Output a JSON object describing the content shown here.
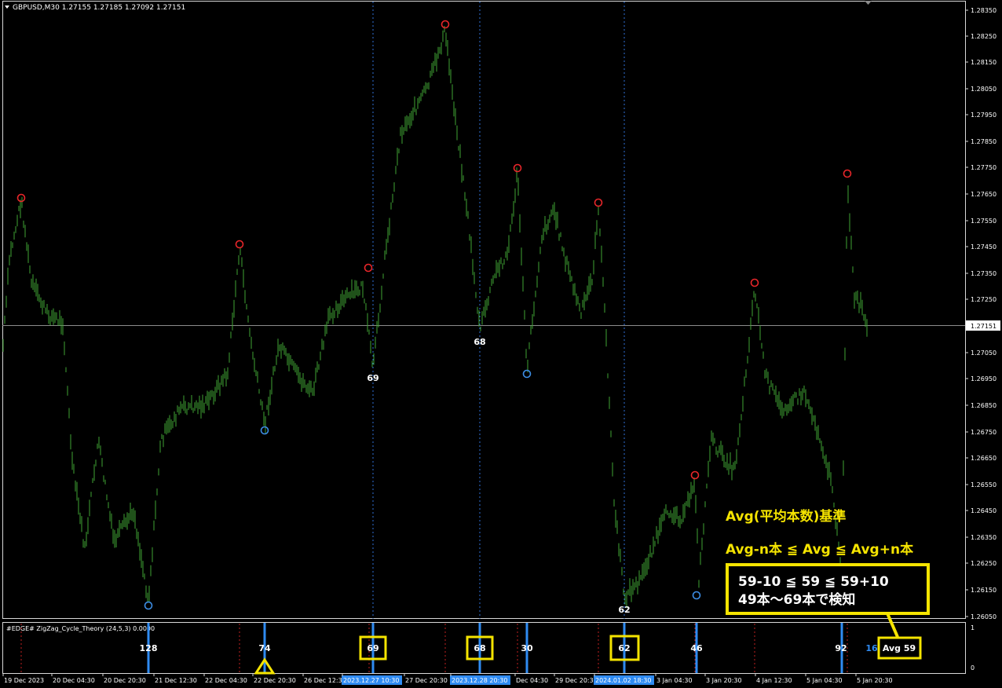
{
  "header": {
    "menu_icon": "triangle-down-icon",
    "title": "GBPUSD,M30  1.27155 1.27185 1.27092 1.27151"
  },
  "colors": {
    "background": "#000000",
    "candle": "#3fa535",
    "peak_marker": "#e8262a",
    "trough_marker": "#3d8ee6",
    "cycle_line": "#2f8bf2",
    "highlight_box": "#f5e400",
    "annotation_text": "#f5e400",
    "axis_text": "#ffffff",
    "current_price_line": "#8c8c8c"
  },
  "main_chart": {
    "price_ticks": [
      "1.28350",
      "1.28250",
      "1.28150",
      "1.28050",
      "1.27950",
      "1.27850",
      "1.27750",
      "1.27650",
      "1.27550",
      "1.27450",
      "1.27350",
      "1.27250",
      "1.27050",
      "1.26950",
      "1.26850",
      "1.26750",
      "1.26650",
      "1.26550",
      "1.26450",
      "1.26350",
      "1.26250",
      "1.26150",
      "1.26050"
    ],
    "current_price": "1.27151",
    "trough_count_labels": [
      "69",
      "68",
      "62"
    ]
  },
  "annotation": {
    "title": "Avg(平均本数)基準",
    "formula": "Avg-n本 ≦ Avg ≦ Avg+n本",
    "box_line1": "59-10 ≦ 59 ≦ 59+10",
    "box_line2": "49本～69本で検知"
  },
  "subwindow": {
    "title": "#EDGE# ZigZag_Cycle_Theory (24,5,3) 0.0000",
    "scale_top": "1",
    "scale_bottom": "0",
    "counts": [
      "128",
      "74",
      "69",
      "68",
      "30",
      "62",
      "46",
      "92",
      "16"
    ],
    "avg_label": "Avg 59"
  },
  "time_axis": {
    "labels": [
      "19 Dec 2023",
      "20 Dec 04:30",
      "20 Dec 20:30",
      "21 Dec 12:30",
      "22 Dec 04:30",
      "22 Dec 20:30",
      "26 Dec 12:30",
      "2023.12.27 10:30",
      "27 Dec 20:30",
      "2023.12.28 20:30",
      "Dec 04:30",
      "29 Dec 20:30",
      "2024.01.02 18:30",
      "3 Jan 04:30",
      "3 Jan 20:30",
      "4 Jan 12:30",
      "5 Jan 04:30",
      "5 Jan 20:30"
    ]
  }
}
